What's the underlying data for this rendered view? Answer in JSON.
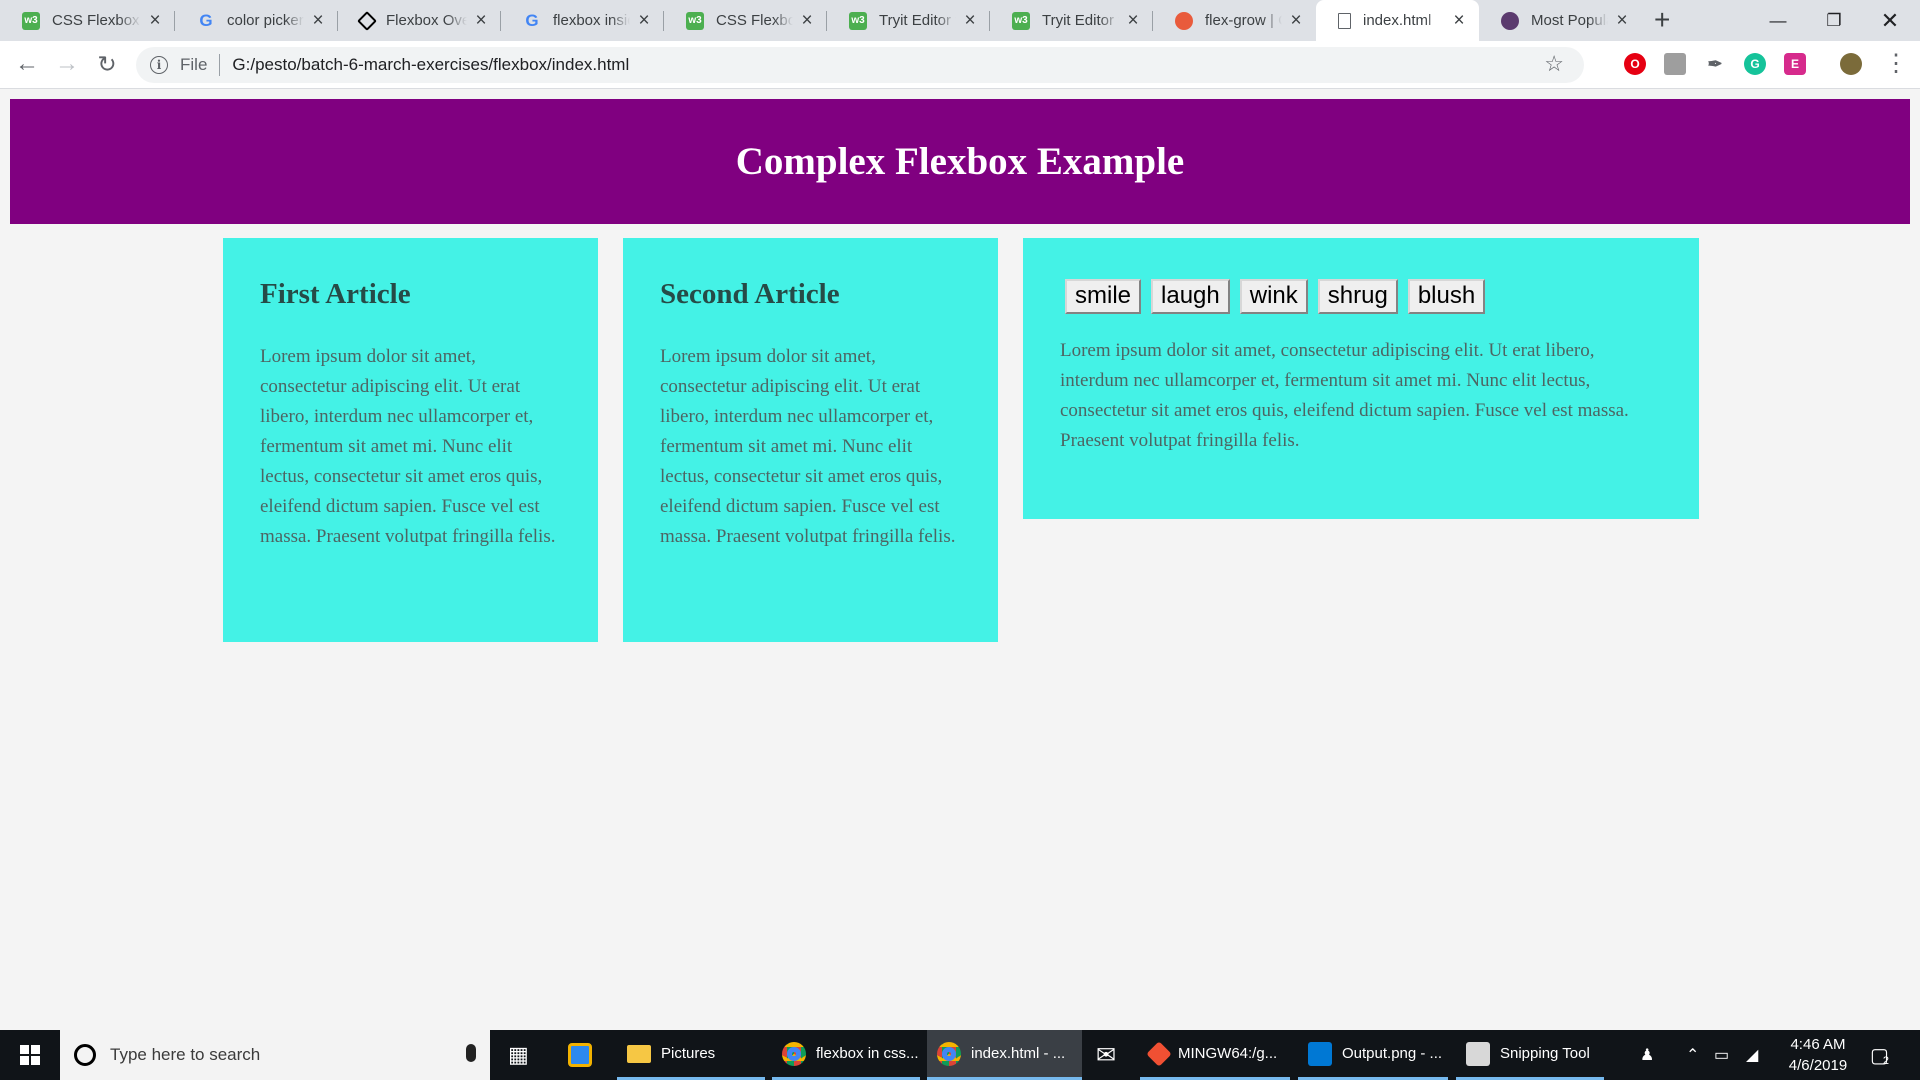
{
  "browser": {
    "tabs": [
      {
        "title": "CSS Flexbox",
        "favicon": "w3schools-icon",
        "active": false
      },
      {
        "title": "color picker",
        "favicon": "google-icon",
        "active": false
      },
      {
        "title": "Flexbox Overview",
        "favicon": "codepen-icon",
        "active": false
      },
      {
        "title": "flexbox inside",
        "favicon": "google-icon",
        "active": false
      },
      {
        "title": "CSS Flexbox",
        "favicon": "w3schools-icon",
        "active": false
      },
      {
        "title": "Tryit Editor v",
        "favicon": "w3schools-icon",
        "active": false
      },
      {
        "title": "Tryit Editor v",
        "favicon": "w3schools-icon",
        "active": false
      },
      {
        "title": "flex-grow | C",
        "favicon": "css-tricks-icon",
        "active": false
      },
      {
        "title": "index.html",
        "favicon": "document-icon",
        "active": true
      },
      {
        "title": "Most Popula",
        "favicon": "site-icon",
        "active": false
      }
    ],
    "address": {
      "scheme_label": "File",
      "url": "G:/pesto/batch-6-march-exercises/flexbox/index.html"
    }
  },
  "page": {
    "heading": "Complex Flexbox Example",
    "articles": [
      {
        "title": "First Article",
        "body": "Lorem ipsum dolor sit amet, consectetur adipiscing elit. Ut erat libero, interdum nec ullamcorper et, fermentum sit amet mi. Nunc elit lectus, consectetur sit amet eros quis, eleifend dictum sapien. Fusce vel est massa. Praesent volutpat fringilla felis."
      },
      {
        "title": "Second Article",
        "body": "Lorem ipsum dolor sit amet, consectetur adipiscing elit. Ut erat libero, interdum nec ullamcorper et, fermentum sit amet mi. Nunc elit lectus, consectetur sit amet eros quis, eleifend dictum sapien. Fusce vel est massa. Praesent volutpat fringilla felis."
      },
      {
        "buttons": [
          "smile",
          "laugh",
          "wink",
          "shrug",
          "blush"
        ],
        "body": "Lorem ipsum dolor sit amet, consectetur adipiscing elit. Ut erat libero, interdum nec ullamcorper et, fermentum sit amet mi. Nunc elit lectus, consectetur sit amet eros quis, eleifend dictum sapien. Fusce vel est massa. Praesent volutpat fringilla felis."
      }
    ],
    "colors": {
      "banner": "#800080",
      "article": "#44f2e6"
    }
  },
  "taskbar": {
    "search_placeholder": "Type here to search",
    "apps": [
      {
        "label": "Pictures",
        "icon": "folder-icon"
      },
      {
        "label": "flexbox in css...",
        "icon": "chrome-icon"
      },
      {
        "label": "index.html - ...",
        "icon": "chrome-icon"
      },
      {
        "label": "MINGW64:/g...",
        "icon": "git-icon"
      },
      {
        "label": "Output.png - ...",
        "icon": "vscode-icon"
      },
      {
        "label": "Snipping Tool",
        "icon": "snipping-tool-icon"
      }
    ],
    "clock": {
      "time": "4:46 AM",
      "date": "4/6/2019"
    },
    "notification_count": "2"
  }
}
